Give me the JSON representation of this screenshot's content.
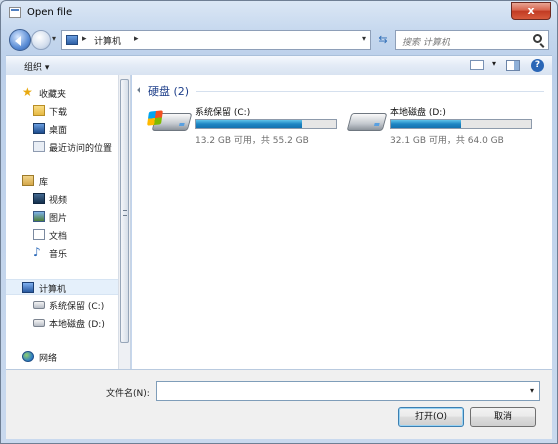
{
  "window": {
    "title": "Open file",
    "close": "x"
  },
  "nav": {
    "path": [
      "计算机"
    ],
    "search_placeholder": "搜索 计算机"
  },
  "toolbar": {
    "organize": "组织 ▾"
  },
  "sidebar": {
    "favorites": {
      "label": "收藏夹",
      "items": [
        {
          "label": "下载",
          "icon": "download-folder-icon"
        },
        {
          "label": "桌面",
          "icon": "desktop-icon"
        },
        {
          "label": "最近访问的位置",
          "icon": "recent-places-icon"
        }
      ]
    },
    "libraries": {
      "label": "库",
      "items": [
        {
          "label": "视频",
          "icon": "video-library-icon"
        },
        {
          "label": "图片",
          "icon": "pictures-library-icon"
        },
        {
          "label": "文档",
          "icon": "documents-library-icon"
        },
        {
          "label": "音乐",
          "icon": "music-library-icon"
        }
      ]
    },
    "computer": {
      "label": "计算机",
      "items": [
        {
          "label": "系统保留 (C:)",
          "icon": "drive-icon"
        },
        {
          "label": "本地磁盘 (D:)",
          "icon": "drive-icon"
        }
      ]
    },
    "network": {
      "label": "网络"
    }
  },
  "content": {
    "group_title": "硬盘 (2)",
    "drives": [
      {
        "name": "系统保留 (C:)",
        "info": "13.2 GB 可用，共 55.2 GB",
        "used_fraction": 0.76,
        "system": true
      },
      {
        "name": "本地磁盘 (D:)",
        "info": "32.1 GB 可用，共 64.0 GB",
        "used_fraction": 0.5,
        "system": false
      }
    ]
  },
  "footer": {
    "filename_label": "文件名(N):",
    "filename_value": "",
    "open_label": "打开(O)",
    "cancel_label": "取消"
  }
}
